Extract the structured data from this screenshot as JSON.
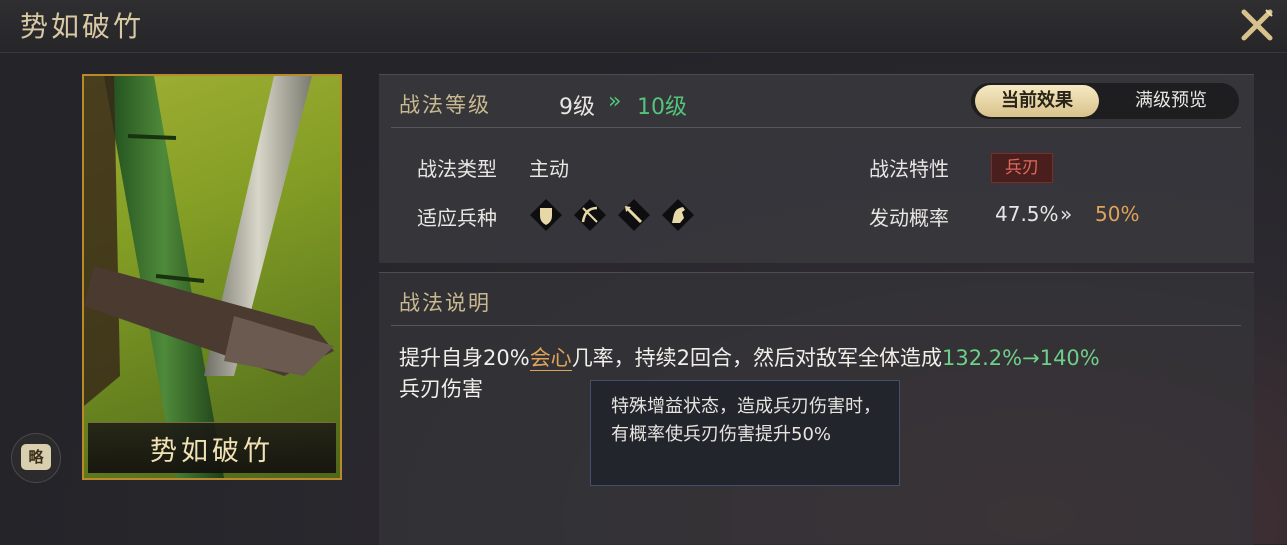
{
  "window": {
    "title": "势如破竹"
  },
  "card": {
    "name": "势如破竹"
  },
  "side_button": {
    "label": "略"
  },
  "tactic": {
    "level_label": "战法等级",
    "current_level": "9级",
    "level_arrow": "»",
    "next_level": "10级",
    "tabs": [
      {
        "label": "当前效果",
        "active": true
      },
      {
        "label": "满级预览",
        "active": false
      }
    ],
    "type_label": "战法类型",
    "type_value": "主动",
    "trait_label": "战法特性",
    "trait_value": "兵刃",
    "troops_label": "适应兵种",
    "troop_icons": [
      "shield-icon",
      "bow-icon",
      "spear-icon",
      "horse-icon"
    ],
    "prob_label": "发动概率",
    "prob_current": "47.5%",
    "prob_arrow": "»",
    "prob_next": "50%"
  },
  "description": {
    "header": "战法说明",
    "text_before": "提升自身20%",
    "highlight": "会心",
    "text_middle": "几率，持续2回合，然后对敌军全体造成",
    "damage_range": "132.2%→140%",
    "text_after": "兵刃伤害"
  },
  "tooltip": {
    "text": "特殊增益状态，造成兵刃伤害时，有概率使兵刃伤害提升50%"
  },
  "colors": {
    "accent_gold": "#d8c28c",
    "upgrade_green": "#52c57a",
    "highlight_orange": "#e0a35a",
    "trait_red": "#e0685c"
  }
}
